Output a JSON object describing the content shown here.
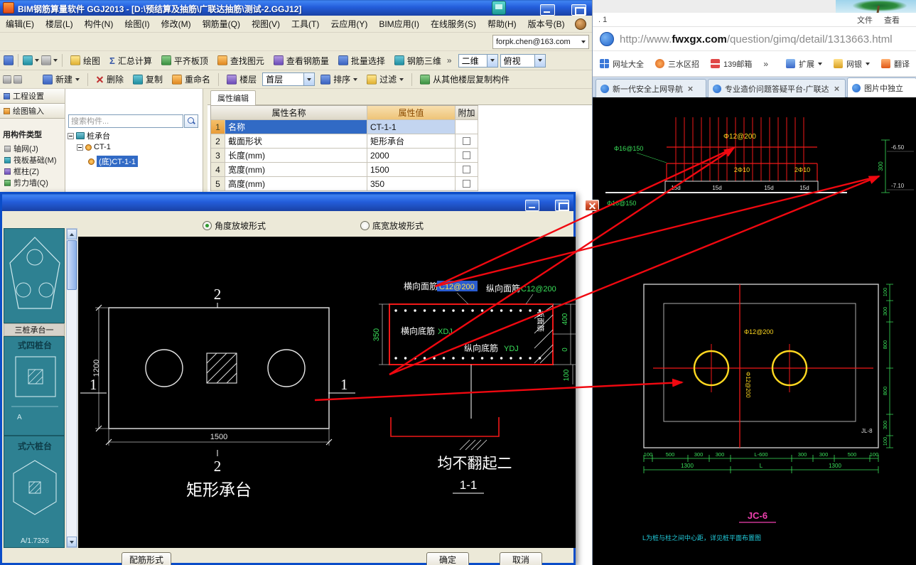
{
  "colors": {
    "xp_titlebar": "#2a62d8",
    "selection_blue": "#316ac5",
    "value_highlight": "#2a5cd0",
    "cad_red": "#f01818",
    "cad_yellow": "#ffd820",
    "cad_green": "#3ae05a",
    "cad_cyan": "#22cede",
    "detail_magenta": "#f040b0",
    "arrow_red": "#f00810",
    "thumb_teal": "#2e8192"
  },
  "icons": {
    "search-icon": "magnifier",
    "close-icon": "x-cross",
    "dropdown-icon": "triangle-down",
    "folder-icon": "teal-folder",
    "component-icon": "orange-dot",
    "mascot-icon": "brown-circle",
    "favicon": "blue-circle"
  },
  "main_window": {
    "title": "BIM钢筋算量软件 GGJ2013 - [D:\\预结算及抽筋\\广联达抽筋\\测试-2.GGJ12]",
    "menu_items": [
      "编辑(E)",
      "楼层(L)",
      "构件(N)",
      "绘图(I)",
      "修改(M)",
      "钢筋量(Q)",
      "视图(V)",
      "工具(T)",
      "云应用(Y)",
      "BIM应用(I)",
      "在线服务(S)",
      "帮助(H)",
      "版本号(B)"
    ],
    "account": "forpk.chen@163.com",
    "toolbar_main": [
      "绘图",
      "汇总计算",
      "平齐板顶",
      "查找图元",
      "查看钢筋量",
      "批量选择",
      "钢筋三维"
    ],
    "overflow_chevron": "»",
    "view_mode": "二维",
    "view_angle": "俯视",
    "toolbar_edit": [
      "新建",
      "删除",
      "复制",
      "重命名",
      "楼层",
      "排序",
      "过滤",
      "从其他楼层复制构件"
    ],
    "floor_combo": "首层",
    "nav_buttons": [
      "工程设置",
      "绘图输入"
    ],
    "type_list_title": "用构件类型",
    "type_items": [
      "轴网(J)",
      "筏板基础(M)",
      "框柱(Z)",
      "剪力墙(Q)"
    ],
    "search_placeholder": "搜索构件...",
    "tree": {
      "root": "桩承台",
      "child": "CT-1",
      "leaf": "(底)CT-1-1"
    },
    "prop_tab": "属性编辑",
    "prop_headers": [
      "属性名称",
      "属性值",
      "附加"
    ],
    "prop_rows": [
      {
        "no": "1",
        "name": "名称",
        "value": "CT-1-1"
      },
      {
        "no": "2",
        "name": "截面形状",
        "value": "矩形承台"
      },
      {
        "no": "3",
        "name": "长度(mm)",
        "value": "2000"
      },
      {
        "no": "4",
        "name": "宽度(mm)",
        "value": "1500"
      },
      {
        "no": "5",
        "name": "高度(mm)",
        "value": "350"
      }
    ]
  },
  "dialog": {
    "radio_angle": "角度放坡形式",
    "radio_width": "底宽放坡形式",
    "thumbs": {
      "label1": "三桩承台一",
      "label2": "式四桩台",
      "label3": "式六桩台",
      "footer3": "A/1.7326",
      "mark2": "A"
    },
    "buttons": {
      "rebar": "配筋形式",
      "ok": "确定",
      "cancel": "取消"
    },
    "plan": {
      "section_mark_2": "2",
      "section_mark_1": "1",
      "dim_height": "1200",
      "dim_width": "1500",
      "caption": "矩形承台"
    },
    "section": {
      "label_top_h": "横向面筋",
      "value_top_h": "C12@200",
      "label_top_v": "纵向面筋",
      "value_top_v": "C12@200",
      "label_bot_h": "横向底筋",
      "value_bot_h": "XDJ",
      "label_bot_v": "纵向底筋",
      "value_bot_v": "YDJ",
      "side_label": "板面筋",
      "dim_thickness": "350",
      "dim_400": "400",
      "dim_0": "0",
      "dim_100": "100",
      "note": "均不翻起二",
      "cut_mark": "1-1"
    }
  },
  "browser": {
    "window_label": ". 1",
    "menu": [
      "文件",
      "查看"
    ],
    "url_prefix": "http://www.",
    "url_domain": "fwxgx.com",
    "url_path": "/question/gimq/detail/1313663.html",
    "bookmarks": [
      "网址大全",
      "三水区招",
      "139邮箱"
    ],
    "overflow_chevron": "»",
    "tools": [
      "扩展",
      "网银",
      "翻译"
    ],
    "tabs": [
      "新一代安全上网导航",
      "专业造价问题答疑平台-广联达",
      "图片中独立"
    ],
    "cad": {
      "top": {
        "rebar_label": "Φ12@200",
        "bar_label": "2Φ10",
        "anchor_label": "15d",
        "mesh_label": "Φ16@150",
        "dim_300": "300",
        "elev_1": "-6.50",
        "elev_2": "-7.10"
      },
      "plan": {
        "rebar_label": "Φ12@200",
        "member_mark": "JL-8",
        "dims_bottom": [
          "100",
          "500",
          "300",
          "300",
          "L-600",
          "300",
          "300",
          "500",
          "100"
        ],
        "dims_total": [
          "1300",
          "L",
          "1300"
        ],
        "dims_right": [
          "100",
          "300",
          "800",
          "800",
          "300",
          "100"
        ]
      },
      "detail_id": "JC-6",
      "note": "L为桩与柱之间中心距，详见桩平面布置图"
    }
  }
}
